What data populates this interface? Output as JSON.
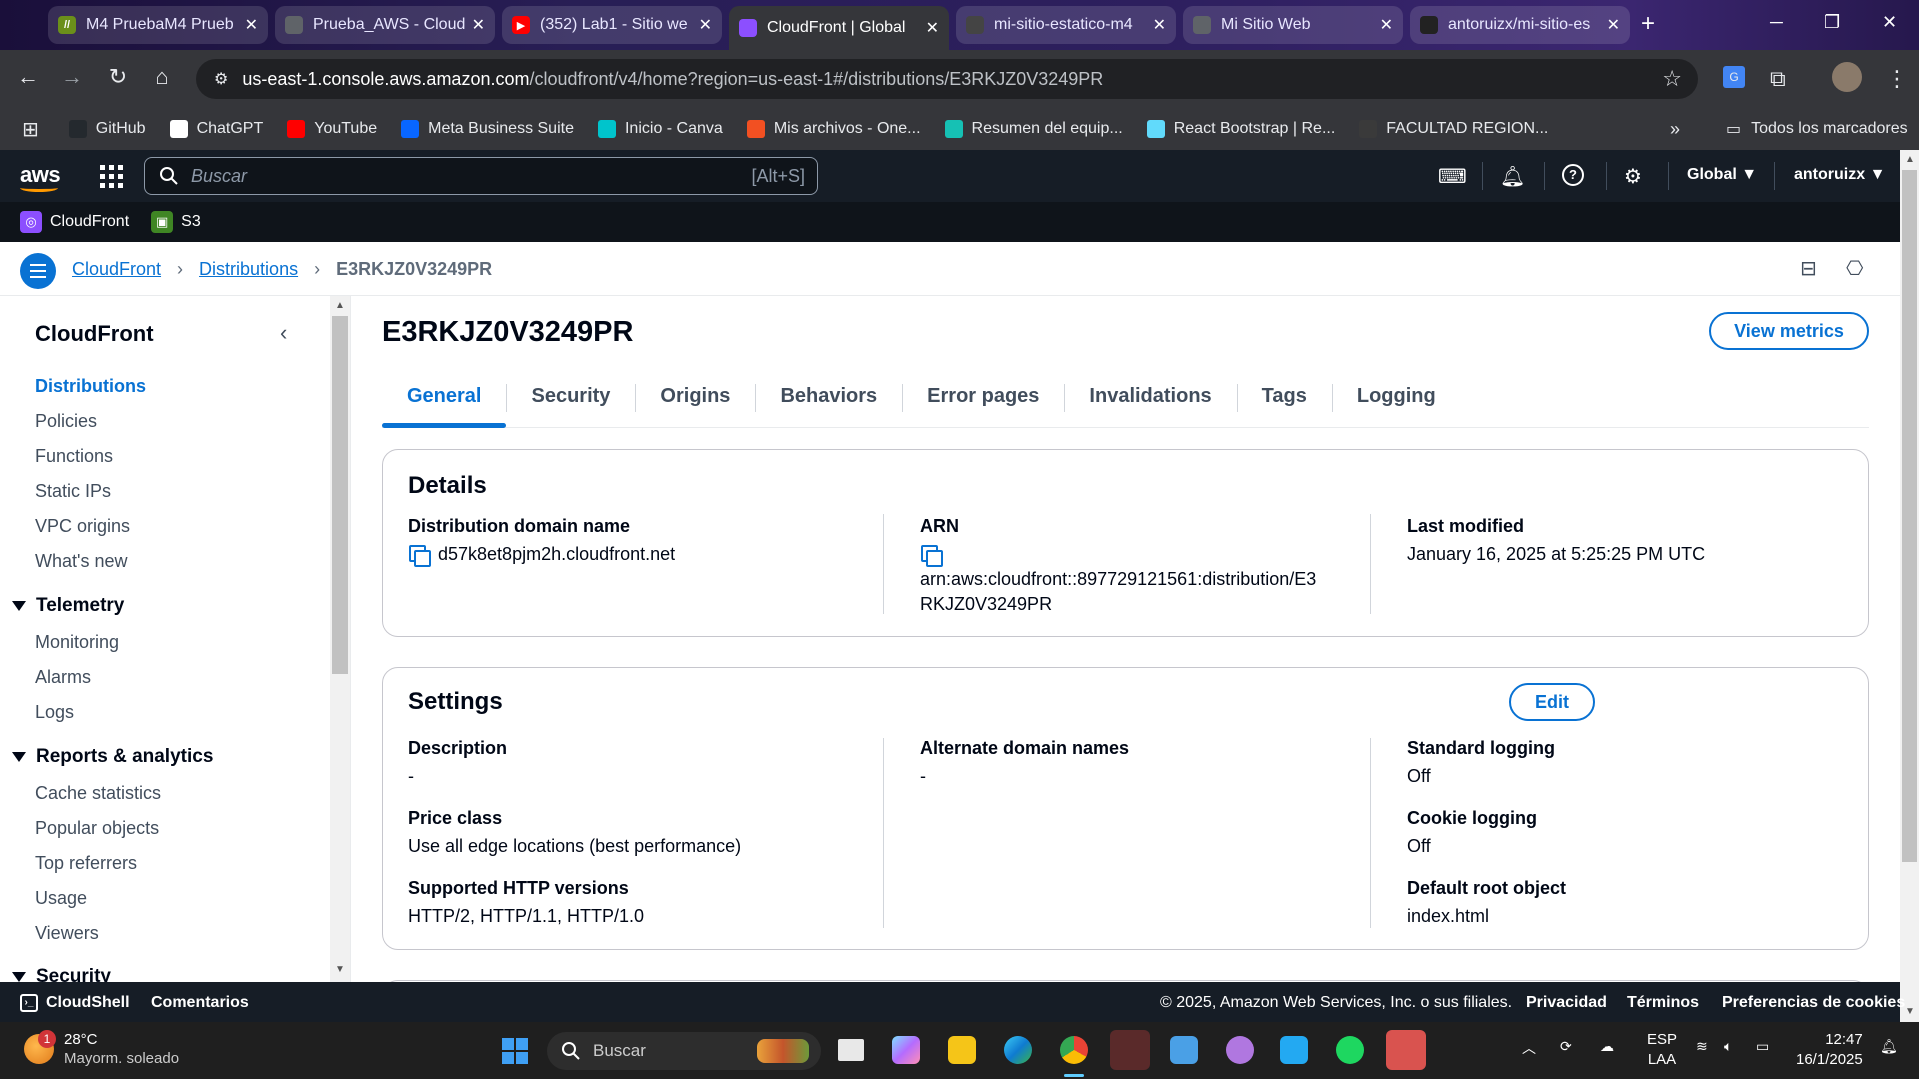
{
  "browser": {
    "tabs": [
      {
        "title": "M4 PruebaM4 Prueb",
        "fav_color": "#6b8f1a",
        "fav_char": "//"
      },
      {
        "title": "Prueba_AWS - Cloud",
        "fav_color": "#5f6368",
        "fav_char": ""
      },
      {
        "title": "(352) Lab1 - Sitio we",
        "fav_color": "#ff0000",
        "fav_char": "▶"
      },
      {
        "title": "CloudFront | Global",
        "fav_color": "#8c4fff",
        "fav_char": ""
      },
      {
        "title": "mi-sitio-estatico-m4",
        "fav_color": "#444",
        "fav_char": ""
      },
      {
        "title": "Mi Sitio Web",
        "fav_color": "#5f6368",
        "fav_char": ""
      },
      {
        "title": "antoruizx/mi-sitio-es",
        "fav_color": "#222",
        "fav_char": ""
      }
    ],
    "active_tab": 3,
    "url_host": "us-east-1.console.aws.amazon.com",
    "url_path": "/cloudfront/v4/home?region=us-east-1#/distributions/E3RKJZ0V3249PR",
    "bookmarks": [
      {
        "label": "GitHub",
        "color": "#24292e"
      },
      {
        "label": "ChatGPT",
        "color": "#ffffff"
      },
      {
        "label": "YouTube",
        "color": "#ff0000"
      },
      {
        "label": "Meta Business Suite",
        "color": "#0866ff"
      },
      {
        "label": "Inicio - Canva",
        "color": "#00c4cc"
      },
      {
        "label": "Mis archivos - One...",
        "color": "#f25022"
      },
      {
        "label": "Resumen del equip...",
        "color": "#16c1b4"
      },
      {
        "label": "React Bootstrap | Re...",
        "color": "#61dafb"
      },
      {
        "label": "FACULTAD REGION...",
        "color": "#3a3a3a"
      }
    ],
    "all_bookmarks": "Todos los marcadores"
  },
  "aws": {
    "search_placeholder": "Buscar",
    "search_shortcut": "[Alt+S]",
    "region": "Global ▼",
    "user": "antoruizx ▼",
    "favorites": [
      {
        "label": "CloudFront",
        "color": "#8c4fff"
      },
      {
        "label": "S3",
        "color": "#3f8624"
      }
    ]
  },
  "breadcrumb": {
    "items": [
      "CloudFront",
      "Distributions"
    ],
    "current": "E3RKJZ0V3249PR"
  },
  "sidenav": {
    "title": "CloudFront",
    "items": [
      "Distributions",
      "Policies",
      "Functions",
      "Static IPs",
      "VPC origins",
      "What's new"
    ],
    "telemetry_title": "Telemetry",
    "telemetry_items": [
      "Monitoring",
      "Alarms",
      "Logs"
    ],
    "reports_title": "Reports & analytics",
    "reports_items": [
      "Cache statistics",
      "Popular objects",
      "Top referrers",
      "Usage",
      "Viewers"
    ],
    "security_title": "Security"
  },
  "main": {
    "title": "E3RKJZ0V3249PR",
    "view_metrics": "View metrics",
    "tabs": [
      "General",
      "Security",
      "Origins",
      "Behaviors",
      "Error pages",
      "Invalidations",
      "Tags",
      "Logging"
    ],
    "details": {
      "title": "Details",
      "domain_label": "Distribution domain name",
      "domain_value": "d57k8et8pjm2h.cloudfront.net",
      "arn_label": "ARN",
      "arn_line1": "arn:aws:cloudfront::897729121561:distribution/E3",
      "arn_line2": "RKJZ0V3249PR",
      "modified_label": "Last modified",
      "modified_value": "January 16, 2025 at 5:25:25 PM UTC"
    },
    "settings": {
      "title": "Settings",
      "edit": "Edit",
      "description_label": "Description",
      "description_value": "-",
      "price_label": "Price class",
      "price_value": "Use all edge locations (best performance)",
      "http_label": "Supported HTTP versions",
      "http_value": "HTTP/2, HTTP/1.1, HTTP/1.0",
      "alt_label": "Alternate domain names",
      "alt_value": "-",
      "stdlog_label": "Standard logging",
      "stdlog_value": "Off",
      "cookie_label": "Cookie logging",
      "cookie_value": "Off",
      "root_label": "Default root object",
      "root_value": "index.html"
    }
  },
  "footer": {
    "cloudshell": "CloudShell",
    "feedback": "Comentarios",
    "copyright": "© 2025, Amazon Web Services, Inc. o sus filiales.",
    "privacy": "Privacidad",
    "terms": "Términos",
    "cookies": "Preferencias de cookies"
  },
  "taskbar": {
    "temp": "28°C",
    "weather": "Mayorm. soleado",
    "weather_badge": "1",
    "search": "Buscar",
    "lang1": "ESP",
    "lang2": "LAA",
    "time": "12:47",
    "date": "16/1/2025"
  }
}
